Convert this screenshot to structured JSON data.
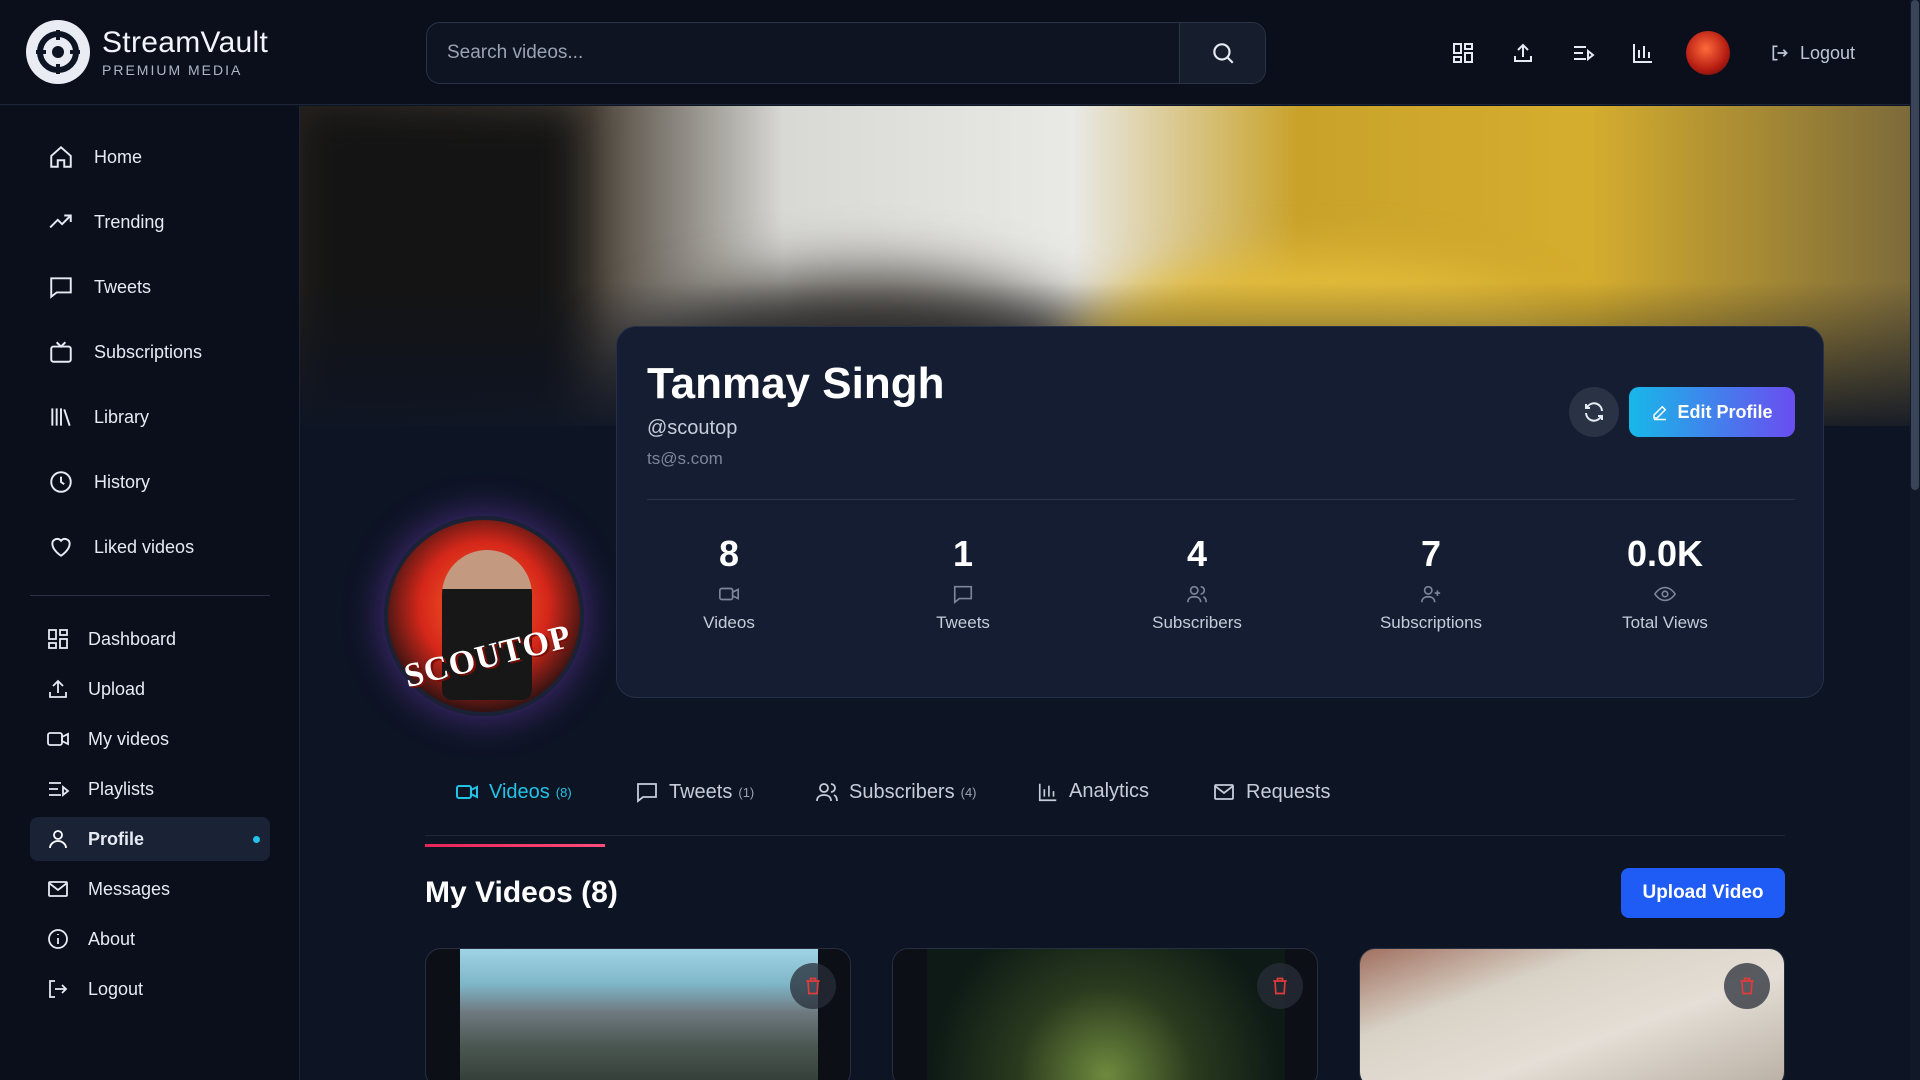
{
  "app": {
    "name": "StreamVault",
    "tagline": "PREMIUM MEDIA"
  },
  "search": {
    "placeholder": "Search videos..."
  },
  "topbar": {
    "logout_label": "Logout"
  },
  "sidebar": {
    "primary": [
      {
        "label": "Home",
        "icon": "home-icon"
      },
      {
        "label": "Trending",
        "icon": "trending-icon"
      },
      {
        "label": "Tweets",
        "icon": "tweet-icon"
      },
      {
        "label": "Subscriptions",
        "icon": "subscriptions-icon"
      },
      {
        "label": "Library",
        "icon": "library-icon"
      },
      {
        "label": "History",
        "icon": "history-icon"
      },
      {
        "label": "Liked videos",
        "icon": "heart-icon"
      }
    ],
    "secondary": [
      {
        "label": "Dashboard",
        "icon": "dashboard-icon"
      },
      {
        "label": "Upload",
        "icon": "upload-icon"
      },
      {
        "label": "My videos",
        "icon": "video-icon"
      },
      {
        "label": "Playlists",
        "icon": "playlist-icon"
      },
      {
        "label": "Profile",
        "icon": "user-icon",
        "active": true
      },
      {
        "label": "Messages",
        "icon": "mail-icon"
      },
      {
        "label": "About",
        "icon": "info-icon"
      },
      {
        "label": "Logout",
        "icon": "logout-icon"
      }
    ]
  },
  "profile": {
    "name": "Tanmay Singh",
    "handle": "@scoutop",
    "email": "ts@s.com",
    "avatar_text": "SCOUTOP",
    "edit_label": "Edit Profile"
  },
  "stats": [
    {
      "value": "8",
      "label": "Videos",
      "icon": "video-icon"
    },
    {
      "value": "1",
      "label": "Tweets",
      "icon": "tweet-icon"
    },
    {
      "value": "4",
      "label": "Subscribers",
      "icon": "users-icon"
    },
    {
      "value": "7",
      "label": "Subscriptions",
      "icon": "user-plus-icon"
    },
    {
      "value": "0.0K",
      "label": "Total Views",
      "icon": "eye-icon"
    }
  ],
  "tabs": [
    {
      "label": "Videos",
      "count": "(8)",
      "active": true
    },
    {
      "label": "Tweets",
      "count": "(1)"
    },
    {
      "label": "Subscribers",
      "count": "(4)"
    },
    {
      "label": "Analytics",
      "count": ""
    },
    {
      "label": "Requests",
      "count": ""
    }
  ],
  "section": {
    "title": "My Videos (8)",
    "upload_label": "Upload Video"
  },
  "colors": {
    "accent": "#22c3e6",
    "primary_button": "#1e5cf5",
    "tab_underline": "#e6245a",
    "delete": "#e23b3b"
  }
}
